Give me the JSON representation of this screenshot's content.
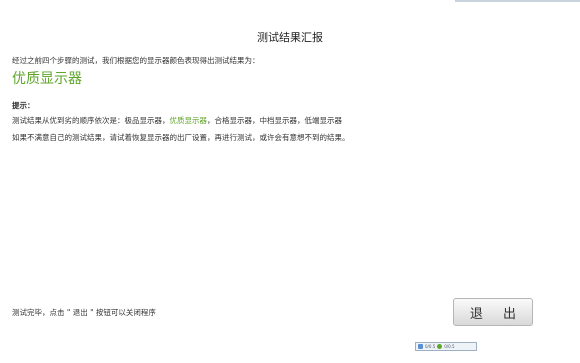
{
  "window": {
    "title": "测试结果汇报"
  },
  "report": {
    "intro": "经过之前四个步骤的测试，我们根据您的显示器颜色表现得出测试结果为：",
    "result": "优质显示器",
    "result_color": "#5fa62a"
  },
  "tips": {
    "title": "提示：",
    "line1_prefix": "测试结果从优到劣的顺序依次是：极品显示器，",
    "line1_highlight": "优质显示器",
    "line1_suffix": "，合格显示器，中档显示器，低端显示器",
    "line2": "如果不满意自己的测试结果，请试着恢复显示器的出厂设置，再进行测试，或许会有意想不到的结果。"
  },
  "footer": {
    "note": "测试完毕，点击 \" 退出 \" 按钮可以关闭程序",
    "exit_label": "退 出"
  },
  "taskbar": {
    "item1": "0/0.5",
    "item2": "0/0.5"
  }
}
